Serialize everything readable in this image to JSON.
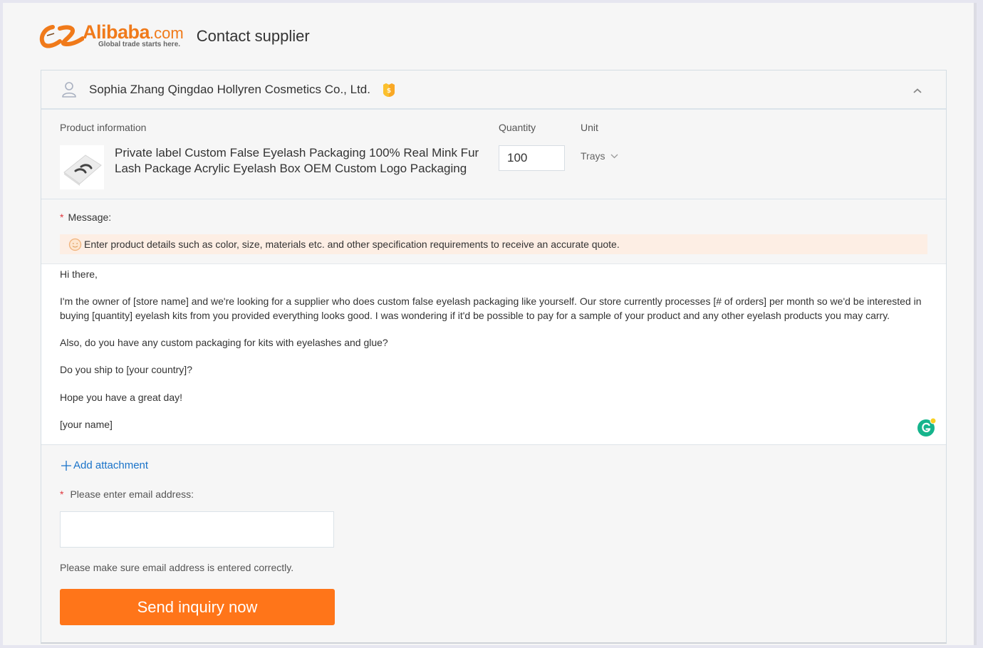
{
  "header": {
    "logo_brand": "Alibaba",
    "logo_suffix": ".com",
    "logo_tagline": "Global trade starts here.",
    "page_title": "Contact supplier"
  },
  "supplier": {
    "name": "Sophia Zhang Qingdao Hollyren Cosmetics Co., Ltd.",
    "user_icon": "user-icon",
    "badge_icon": "gold-supplier-badge-icon",
    "collapse_icon": "chevron-up-icon"
  },
  "product": {
    "section_label": "Product information",
    "title": "Private label Custom False Eyelash Packaging 100% Real Mink Fur Lash Package Acrylic Eyelash Box OEM Custom Logo Packaging",
    "thumbnail": "eyelash-box-image",
    "quantity_label": "Quantity",
    "quantity_value": "100",
    "unit_label": "Unit",
    "unit_selected": "Trays"
  },
  "message": {
    "label": "Message:",
    "required_marker": "*",
    "hint_icon": "smile-icon",
    "hint": "Enter product details such as color, size, materials etc. and other specification requirements to receive an accurate quote.",
    "body": "Hi there,\n\nI'm the owner of [store name] and we're looking for a supplier who does custom false eyelash packaging like yourself. Our store currently processes [# of orders] per month so we'd be interested in buying [quantity] eyelash kits from you provided everything looks good. I was wondering if it'd be possible to pay for a sample of your product and any other eyelash products you may carry.\n\nAlso, do you have any custom packaging for kits with eyelashes and glue?\n\nDo you ship to [your country]?\n\nHope you have a great day!\n\n[your name]",
    "grammarly_icon": "grammarly-icon"
  },
  "attachment": {
    "label": "Add attachment",
    "icon": "plus-icon"
  },
  "email": {
    "label": "Please enter email address:",
    "required_marker": "*",
    "value": "",
    "placeholder": "",
    "note": "Please make sure email address is entered correctly."
  },
  "actions": {
    "send_label": "Send inquiry now"
  },
  "colors": {
    "brand_orange": "#ff7519",
    "link_blue": "#1a73c9",
    "required_red": "#e0383e",
    "hint_bg": "#fdeee4"
  }
}
